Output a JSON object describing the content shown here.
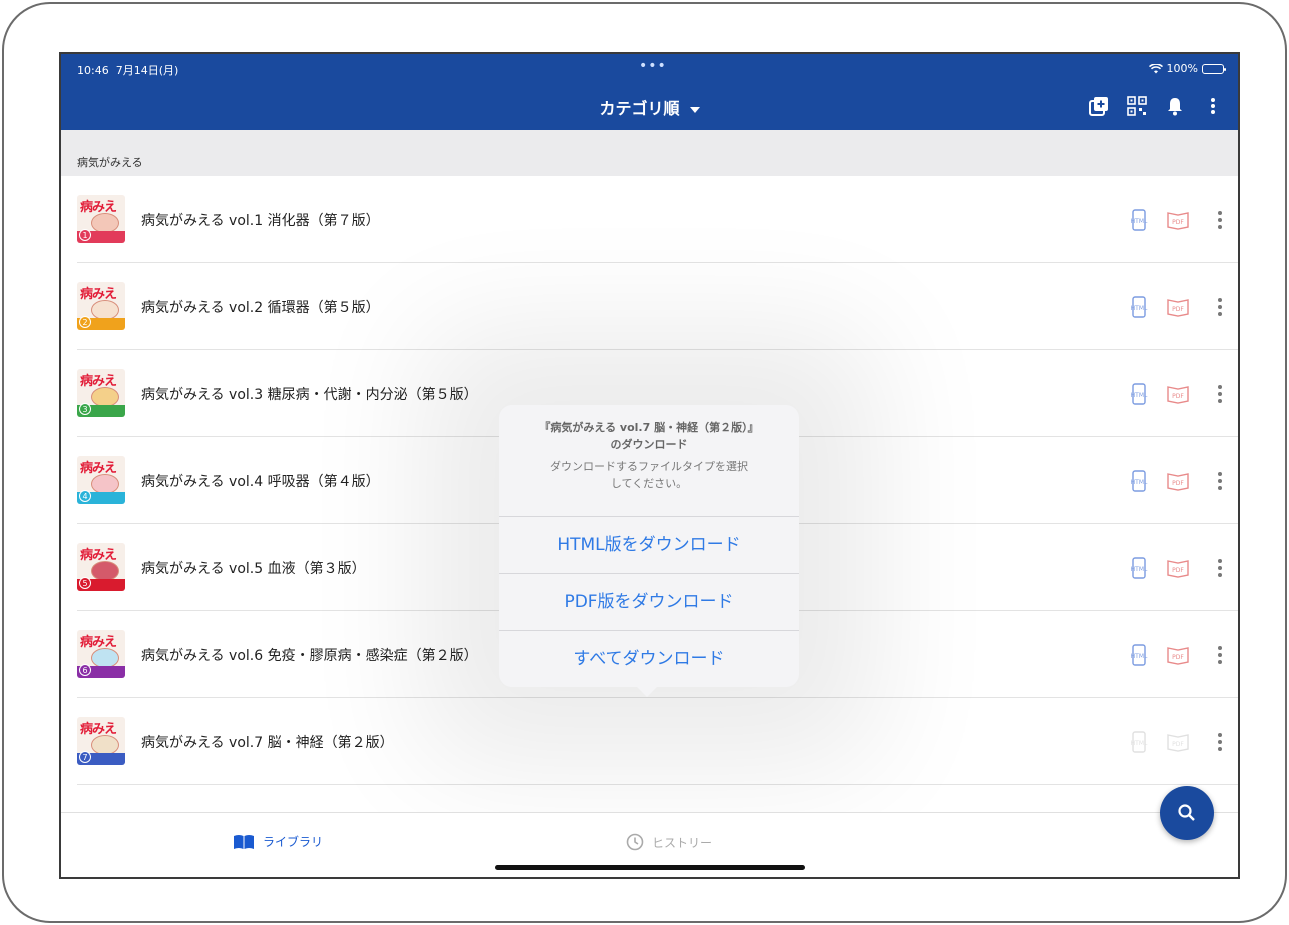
{
  "status_bar": {
    "time": "10:46",
    "date": "7月14日(月)",
    "dots": "•••",
    "battery": "100%"
  },
  "nav": {
    "title": "カテゴリ順"
  },
  "section": {
    "title": "病気がみえる"
  },
  "books": [
    {
      "title": "病気がみえる vol.1 消化器（第７版）",
      "num": "1",
      "band_color": "#e23b5a"
    },
    {
      "title": "病気がみえる vol.2 循環器（第５版）",
      "num": "2",
      "band_color": "#f0a21c"
    },
    {
      "title": "病気がみえる vol.3 糖尿病・代謝・内分泌（第５版）",
      "num": "3",
      "band_color": "#3aa64a"
    },
    {
      "title": "病気がみえる vol.4 呼吸器（第４版）",
      "num": "4",
      "band_color": "#2ab3d9"
    },
    {
      "title": "病気がみえる vol.5 血液（第３版）",
      "num": "5",
      "band_color": "#d91b2e"
    },
    {
      "title": "病気がみえる vol.6 免疫・膠原病・感染症（第２版）",
      "num": "6",
      "band_color": "#8a2ea6"
    },
    {
      "title": "病気がみえる vol.7 脳・神経（第２版）",
      "num": "7",
      "band_color": "#3b5cc2"
    }
  ],
  "icons": {
    "html_label": "HTML",
    "pdf_label": "PDF"
  },
  "dialog": {
    "title_line1": "『病気がみえる vol.7 脳・神経（第２版）』",
    "title_line2": "のダウンロード",
    "message_line1": "ダウンロードするファイルタイプを選択",
    "message_line2": "してください。",
    "options": [
      "HTML版をダウンロード",
      "PDF版をダウンロード",
      "すべてダウンロード"
    ]
  },
  "tabs": {
    "library": "ライブラリ",
    "history": "ヒストリー"
  },
  "colors": {
    "brand": "#1a4a9e",
    "accent": "#2f7ae5",
    "html_icon": "#7b9be0",
    "pdf_icon": "#e88a8a"
  }
}
